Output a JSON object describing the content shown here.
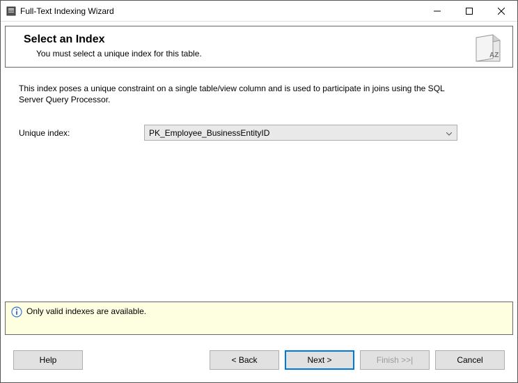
{
  "window": {
    "title": "Full-Text Indexing Wizard"
  },
  "header": {
    "title": "Select an Index",
    "subtitle": "You must select a unique index for this table."
  },
  "body": {
    "description": "This index poses a unique constraint on a single table/view column and is used to participate in joins using the SQL Server Query Processor.",
    "unique_index_label": "Unique index:",
    "unique_index_value": "PK_Employee_BusinessEntityID"
  },
  "info": {
    "message": "Only valid indexes are available."
  },
  "footer": {
    "help": "Help",
    "back": "< Back",
    "next": "Next >",
    "finish": "Finish >>|",
    "cancel": "Cancel"
  }
}
